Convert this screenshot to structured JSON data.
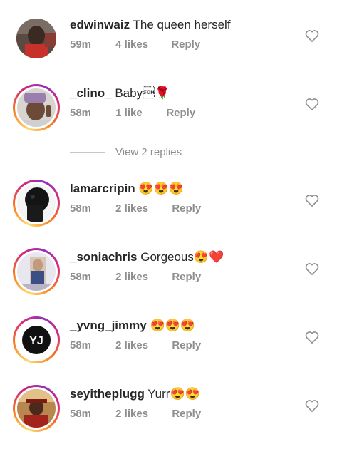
{
  "comments": [
    {
      "username": "edwinwaiz",
      "text": "The queen herself",
      "emoji": "",
      "time": "59m",
      "likes": "4 likes",
      "reply": "Reply",
      "ring": false,
      "avatar": "person-photo"
    },
    {
      "username": "_clino_",
      "text": "Baby\u0001",
      "emoji": "🌹",
      "time": "58m",
      "likes": "1 like",
      "reply": "Reply",
      "ring": true,
      "avatar": "person-photo"
    },
    {
      "username": "lamarcripin",
      "text": "",
      "emoji": "😍😍😍",
      "time": "58m",
      "likes": "2 likes",
      "reply": "Reply",
      "ring": true,
      "avatar": "silhouette-photo"
    },
    {
      "username": "_soniachris",
      "text": "Gorgeous",
      "emoji": "😍❤️",
      "time": "58m",
      "likes": "2 likes",
      "reply": "Reply",
      "ring": true,
      "avatar": "person-photo"
    },
    {
      "username": "_yvng_jimmy",
      "text": "",
      "emoji": "😍😍😍",
      "time": "58m",
      "likes": "2 likes",
      "reply": "Reply",
      "ring": true,
      "avatar": "yj-logo"
    },
    {
      "username": "seyitheplugg",
      "text": "Yurr",
      "emoji": "😍😍",
      "time": "58m",
      "likes": "2 likes",
      "reply": "Reply",
      "ring": true,
      "avatar": "person-photo"
    }
  ],
  "view_replies": "View 2 replies",
  "avatar_logo_text": "YJ",
  "colors": {
    "username": "#262626",
    "meta": "#8e8e8e",
    "divider": "#c7c7c7"
  }
}
